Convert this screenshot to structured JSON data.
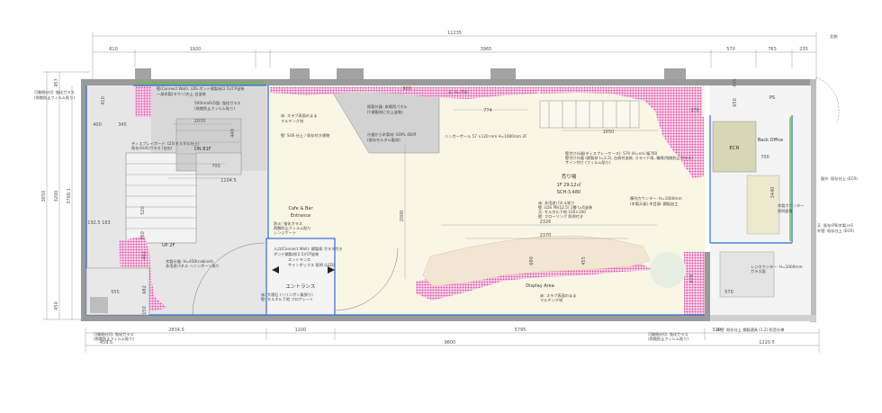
{
  "overall_dims": {
    "total_top": "11235",
    "total_bottom": "9800",
    "top_segments": [
      "610",
      "1920",
      "3965",
      "570",
      "763",
      "235"
    ],
    "bottom_segments": [
      "2834.5",
      "1100",
      "5795",
      "320"
    ],
    "bottom_left": "459.5",
    "bottom_right": "1220.5",
    "left_total": "3650",
    "left_inner": "3200",
    "left_inner2": "3769.1",
    "left_top": "457",
    "left_bottom": "450",
    "right_top": "575",
    "right_bottom": "4050"
  },
  "rooms": {
    "sales_floor": {
      "title": "売り場",
      "area": "1F 29.12㎡",
      "ceiling": "SCH:3,480"
    },
    "cafe_entrance": [
      "Cafe & Bar",
      "Entrance"
    ],
    "entrance": "エントランス",
    "display_area": "Display Area",
    "ecr": "ECR",
    "back_office": "Back Office",
    "ps": "PS",
    "stair_up": "UP  2F",
    "stair_dn": "DN  B1F"
  },
  "notes": {
    "top_left_1": "壁(Connect Wall): LDS ボンド鋼製材(2.5)/CP塗装",
    "top_left_2": "一部木製(ラワン)の上 白塗装",
    "top_left_3": "500mmR/D面: 強化ガラス",
    "top_left_4": "(飛散防止フィルム貼り)",
    "top_mid_1": "床: スラブ表面のまま",
    "top_mid_2": "マルチング材",
    "top_mid_3": "壁: SUS 仕上 / 既存付き建物",
    "counter_1": "既製什器: 来場用パネル",
    "counter_2": "(t 鋼製材に仕上塗装)",
    "counter_3": "什器から木製材: SOPL 4D/R",
    "counter_4": "(既存モルタル製材)",
    "ceiling_h": "天: H=750",
    "hanger": "ハンガーポール 57 ×120 mm H=1600mm 2F",
    "wall_shelf_1": "壁付け什器(ディスプレーケース): 570 (H=nn) 幅760",
    "wall_shelf_2": "壁付け什器 (鋼製材 t=2.3), 白焼付塗装, スライド扉, 電線(飛散防止ガラス)",
    "wall_shelf_3": "サイン付け (フィルム貼り)",
    "floor_1": "床: 多用途パネル張り",
    "floor_2": "壁: LDS PB(12.5) 2層 t=6塗装",
    "floor_3": "天: モルタル下地 100×100",
    "floor_4": "壁: フローリング 照明付き",
    "counter_r1": "陳列カウンター: H=1000mm",
    "counter_r2": "(木製天板) 木目調: 鋼板加工",
    "register_1": "レジカウンター: H=1000mm",
    "register_2": "ガラス面",
    "entrance_1": "入口(Connect Wall): 鋼製扉 ガラス付き",
    "entrance_2": "ボンド鋼製材(2.5)/CP塗装",
    "entrance_3": "エントランス",
    "entrance_4": "天: 既存 RC スラブ, 床: 化粧材, 表面仕上",
    "entrance_5": "サインボックス 照明 (LED)",
    "ent_floor_1": "床: 大理石 (ヘリンボン風張り)",
    "ent_floor_2": "壁: モルタル下地 フロアシート",
    "stair_1": "ディスプレイボード: t25(モルタル仕上)",
    "stair_2": "既存(SUS)ガラス (白化)",
    "cafe_wall_1": "防火: 強化ガラス",
    "cafe_wall_2": "飛散防止フィルム貼り",
    "cafe_wall_3": "シンジケート",
    "bottom_left_1": "木製什器: H=450(cabinet)",
    "bottom_left_2": "多用途パネル ヘリンボーン張り",
    "left_1": "可動間仕切: 強化ガラス",
    "left_2": "(飛散防止フィルム貼り)",
    "right_1": "木製カウンター",
    "right_2": "照明設備",
    "right_3": "屋外: 既存 (ECR)",
    "right_4": "床: 既存仕上 フォトラ 床面",
    "display_1": "床: スラブ表面のまま",
    "display_2": "マルチング材",
    "bottom_note_l1": "可動間仕切: 強化ガラス",
    "bottom_note_l2": "(飛散防止フィルム貼り)",
    "bottom_note_r1": "可動間仕切: 強化ガラス",
    "bottom_note_r2": "(飛散防止フィルム貼り)",
    "bottom_note_far": "外壁: 既存仕上 鋼製建具 (1.2) 防音仕様",
    "far_right_1": "屋外: 既存仕上 (ECR)",
    "far_right_2": "天: 既存(PB/木製)+S",
    "far_right_3": "外壁: 既存仕上 (ECR)",
    "north": "北側"
  },
  "inner_dims": {
    "d_2070": "2070",
    "d_700": "700",
    "d_1104": "1104.5",
    "d_774": "774",
    "d_1650": "1650",
    "d_2000": "2000",
    "d_2326": "2326",
    "d_2370": "2370",
    "d_700r": "700",
    "d_3440": "3440",
    "d_555": "555",
    "d_570": "570",
    "d_400": "400",
    "d_345": "345",
    "d_682": "682",
    "d_402": "402",
    "d_250": "250",
    "d_520": "520",
    "d_1925": "192.5 163",
    "d_680": "680",
    "d_455": "455",
    "d_410": "410",
    "d_900": "900",
    "d_370": "370",
    "d_150": "150",
    "d_440": "440",
    "d_429": "429",
    "d_435": "435",
    "d_650": "650"
  },
  "colors": {
    "wall": "#8c8c8c",
    "blue_line": "#2f6fd0",
    "pink_hatch": "#e040a0",
    "green": "#5ac83c",
    "floor_gray": "#d9d9d9",
    "sales_floor": "#faf6e6",
    "display": "#f2e6d2"
  }
}
